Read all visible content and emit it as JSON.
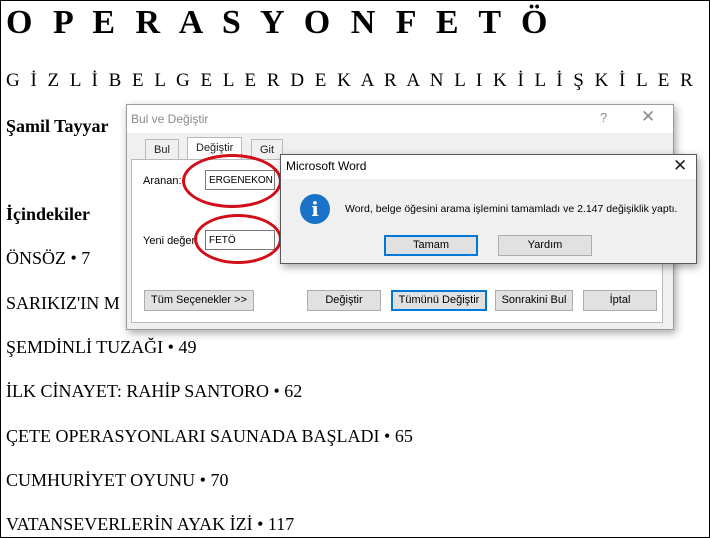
{
  "document": {
    "title": "O P E R A S Y O N F E T Ö",
    "subtitle": "G İ Z L İ B E L G E L E R D E K A R A N L I K İ L İ Ş K İ L E R",
    "author": "Şamil Tayyar",
    "toc_heading": "İçindekiler",
    "toc": [
      "ÖNSÖZ • 7",
      "SARIKIZ'IN M",
      "ŞEMDİNLİ TUZAĞI • 49",
      "İLK CİNAYET: RAHİP SANTORO • 62",
      "ÇETE OPERASYONLARI SAUNADA BAŞLADI • 65",
      "CUMHURİYET OYUNU • 70",
      "VATANSEVERLERİN AYAK İZİ • 117"
    ]
  },
  "find_replace": {
    "title": "Bul ve Değiştir",
    "help_symbol": "?",
    "close_symbol": "✕",
    "tabs": [
      "Bul",
      "Değiştir",
      "Git"
    ],
    "active_tab": "Değiştir",
    "find_label": "Aranan:",
    "find_value": "ERGENEKON",
    "replace_label": "Yeni değer:",
    "replace_value": "FETÖ",
    "more_button": "Tüm Seçenekler >>",
    "replace_button": "Değiştir",
    "replace_all_button": "Tümünü Değiştir",
    "find_next_button": "Sonrakini Bul",
    "cancel_button": "İptal"
  },
  "message_box": {
    "title": "Microsoft Word",
    "close_symbol": "✕",
    "icon": "info-icon",
    "icon_glyph": "i",
    "message": "Word, belge öğesini arama işlemini tamamladı ve 2.147 değişiklik yaptı.",
    "ok_button": "Tamam",
    "help_button": "Yardım"
  },
  "colors": {
    "annotation_circle": "#d10e1a",
    "info_icon": "#1a73c8",
    "focus_border": "#0078d7"
  }
}
